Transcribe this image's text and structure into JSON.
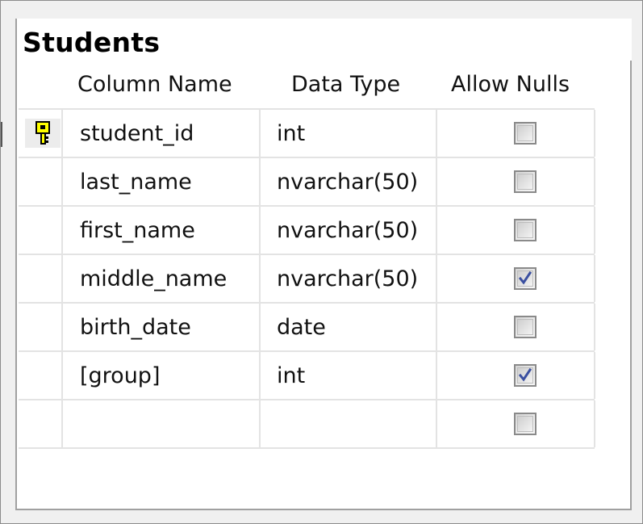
{
  "table": {
    "title": "Students",
    "columns": {
      "name": "Column Name",
      "type": "Data Type",
      "nulls": "Allow Nulls"
    },
    "rows": [
      {
        "name": "student_id",
        "type": "int",
        "allow_nulls": false,
        "primary_key": true
      },
      {
        "name": "last_name",
        "type": "nvarchar(50)",
        "allow_nulls": false,
        "primary_key": false
      },
      {
        "name": "first_name",
        "type": "nvarchar(50)",
        "allow_nulls": false,
        "primary_key": false
      },
      {
        "name": "middle_name",
        "type": "nvarchar(50)",
        "allow_nulls": true,
        "primary_key": false
      },
      {
        "name": "birth_date",
        "type": "date",
        "allow_nulls": false,
        "primary_key": false
      },
      {
        "name": "[group]",
        "type": "int",
        "allow_nulls": true,
        "primary_key": false
      },
      {
        "name": "",
        "type": "",
        "allow_nulls": false,
        "primary_key": false
      }
    ]
  },
  "icons": {
    "primary_key": "key-icon",
    "checked": "checkmark-icon"
  },
  "colors": {
    "key": "#ffff00",
    "check": "#3a4fa0"
  }
}
